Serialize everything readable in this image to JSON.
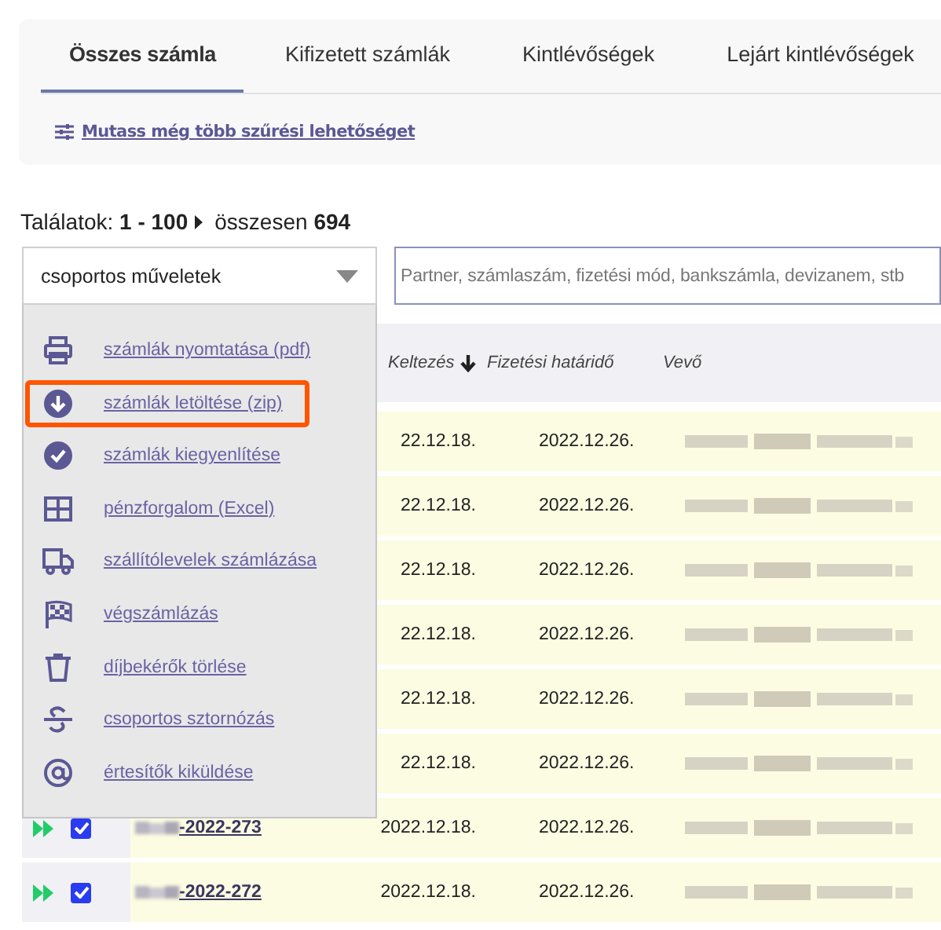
{
  "tabs": [
    {
      "label": "Összes számla",
      "selected": true
    },
    {
      "label": "Kifizetett számlák",
      "selected": false
    },
    {
      "label": "Kintlévőségek",
      "selected": false
    },
    {
      "label": "Lejárt kintlévőségek",
      "selected": false
    }
  ],
  "filter_link": "Mutass még több szűrési lehetőséget",
  "results": {
    "range": "Találatok: **1 - 100**",
    "total": "összesen **694**"
  },
  "bulk_select": {
    "value": "csoportos műveletek",
    "expanded": true
  },
  "search": {
    "placeholder": "Partner, számlaszám, fizetési mód, bankszámla, devizanem, stb"
  },
  "bulk_menu": [
    {
      "kind": "print",
      "label": "számlák nyomtatása (pdf)",
      "highlighted": false
    },
    {
      "kind": "download",
      "label": "számlák letöltése (zip)",
      "highlighted": true
    },
    {
      "kind": "check",
      "label": "számlák kiegyenlítése",
      "highlighted": false
    },
    {
      "kind": "grid",
      "label": "pénzforgalom (Excel)",
      "highlighted": false
    },
    {
      "kind": "truck",
      "label": "szállítólevelek számlázása",
      "highlighted": false
    },
    {
      "kind": "flag",
      "label": "végszámlázás",
      "highlighted": false
    },
    {
      "kind": "trash",
      "label": "díjbekérők törlése",
      "highlighted": false
    },
    {
      "kind": "strike",
      "label": "csoportos sztornózás",
      "highlighted": false
    },
    {
      "kind": "at",
      "label": "értesítők kiküldése",
      "highlighted": false
    }
  ],
  "table": {
    "columns": [
      {
        "label": "Keltezés",
        "sorted": true
      },
      {
        "label": "Fizetési határidő",
        "sorted": false
      },
      {
        "label": "Vevő",
        "sorted": false
      }
    ],
    "rows": [
      {
        "date": "22.12.18.",
        "due": "2022.12.26."
      },
      {
        "date": "22.12.18.",
        "due": "2022.12.26."
      },
      {
        "date": "22.12.18.",
        "due": "2022.12.26."
      },
      {
        "date": "22.12.18.",
        "due": "2022.12.26."
      },
      {
        "date": "22.12.18.",
        "due": "2022.12.26."
      },
      {
        "date": "22.12.18.",
        "due": "2022.12.26."
      },
      {
        "checked": true,
        "invoice": "-2022-273",
        "date": "2022.12.18.",
        "due": "2022.12.26."
      },
      {
        "checked": true,
        "invoice": "-2022-272",
        "date": "2022.12.18.",
        "due": "2022.12.26."
      }
    ]
  }
}
